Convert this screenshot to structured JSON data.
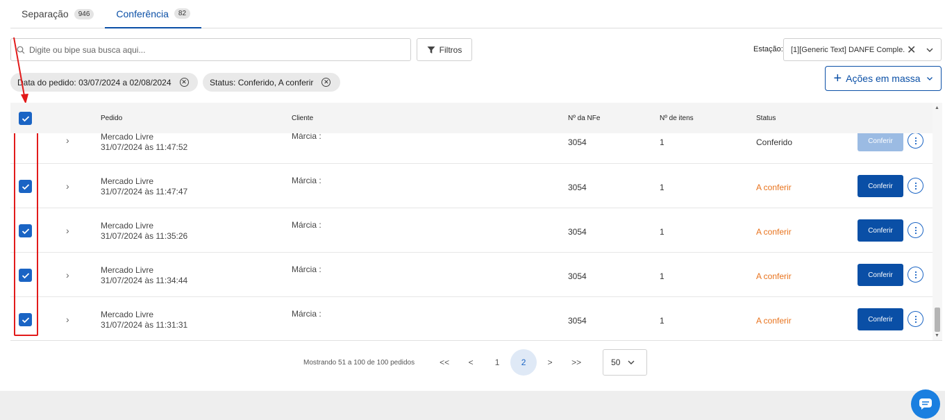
{
  "tabs": [
    {
      "label": "Separação",
      "count": "946"
    },
    {
      "label": "Conferência",
      "count": "82"
    }
  ],
  "search": {
    "placeholder": "Digite ou bipe sua busca aqui..."
  },
  "filters_label": "Filtros",
  "station": {
    "label": "Estação:",
    "value": "[1][Generic Text] DANFE Comple..."
  },
  "chips": [
    {
      "label": "Data do pedido: 03/07/2024 a 02/08/2024"
    },
    {
      "label": "Status: Conferido, A conferir"
    }
  ],
  "mass_actions_label": "Ações em massa",
  "columns": {
    "order": "Pedido",
    "client": "Cliente",
    "nfe": "Nº da NFe",
    "items": "Nº de itens",
    "status": "Status"
  },
  "rows": [
    {
      "store": "Mercado Livre",
      "date": "31/07/2024 às 11:47:52",
      "client": "Márcia :",
      "nfe": "3054",
      "items": "1",
      "status": "Conferido",
      "action": "Conferir",
      "checked": false
    },
    {
      "store": "Mercado Livre",
      "date": "31/07/2024 às 11:47:47",
      "client": "Márcia :",
      "nfe": "3054",
      "items": "1",
      "status": "A conferir",
      "action": "Conferir",
      "checked": true
    },
    {
      "store": "Mercado Livre",
      "date": "31/07/2024 às 11:35:26",
      "client": "Márcia :",
      "nfe": "3054",
      "items": "1",
      "status": "A conferir",
      "action": "Conferir",
      "checked": true
    },
    {
      "store": "Mercado Livre",
      "date": "31/07/2024 às 11:34:44",
      "client": "Márcia :",
      "nfe": "3054",
      "items": "1",
      "status": "A conferir",
      "action": "Conferir",
      "checked": true
    },
    {
      "store": "Mercado Livre",
      "date": "31/07/2024 às 11:31:31",
      "client": "Márcia :",
      "nfe": "3054",
      "items": "1",
      "status": "A conferir",
      "action": "Conferir",
      "checked": true
    }
  ],
  "pagination": {
    "info": "Mostrando 51 a 100 de 100 pedidos",
    "first": "<<",
    "prev": "<",
    "next": ">",
    "last": ">>",
    "pages": [
      "1",
      "2"
    ],
    "current": "2",
    "page_size": "50"
  },
  "colors": {
    "primary": "#0a4fa6",
    "pending": "#e8721c",
    "annotation": "#e21a1a"
  }
}
